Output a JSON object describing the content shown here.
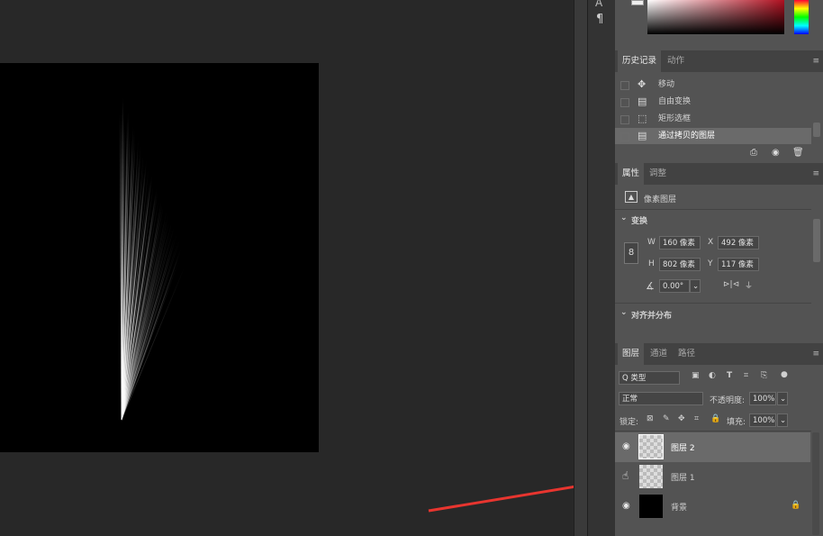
{
  "history_panel": {
    "tabs": [
      "历史记录",
      "动作"
    ],
    "items": [
      "移动",
      "自由变换",
      "矩形选框",
      "通过拷贝的图层"
    ]
  },
  "properties_panel": {
    "tabs": [
      "属性",
      "调整"
    ],
    "layer_type": "像素图层",
    "transform_label": "变换",
    "w_label": "W",
    "w_value": "160 像素",
    "x_label": "X",
    "x_value": "492 像素",
    "h_label": "H",
    "h_value": "802 像素",
    "y_label": "Y",
    "y_value": "117 像素",
    "angle_value": "0.00°",
    "align_label": "对齐并分布"
  },
  "layers_panel": {
    "tabs": [
      "图层",
      "通道",
      "路径"
    ],
    "filter_label": "Q 类型",
    "blend_mode": "正常",
    "opacity_label": "不透明度:",
    "opacity_value": "100%",
    "lock_label": "锁定:",
    "fill_label": "填充:",
    "fill_value": "100%",
    "layers": [
      "图层 2",
      "图层 1",
      "背景"
    ]
  },
  "icons": {
    "menu": "hamburger-icon",
    "paragraph": "¶",
    "move": "✥"
  },
  "colors": {
    "accent_arrow": "#e8352f",
    "panel_bg": "#535353",
    "selected_row": "#6a6a6a"
  }
}
